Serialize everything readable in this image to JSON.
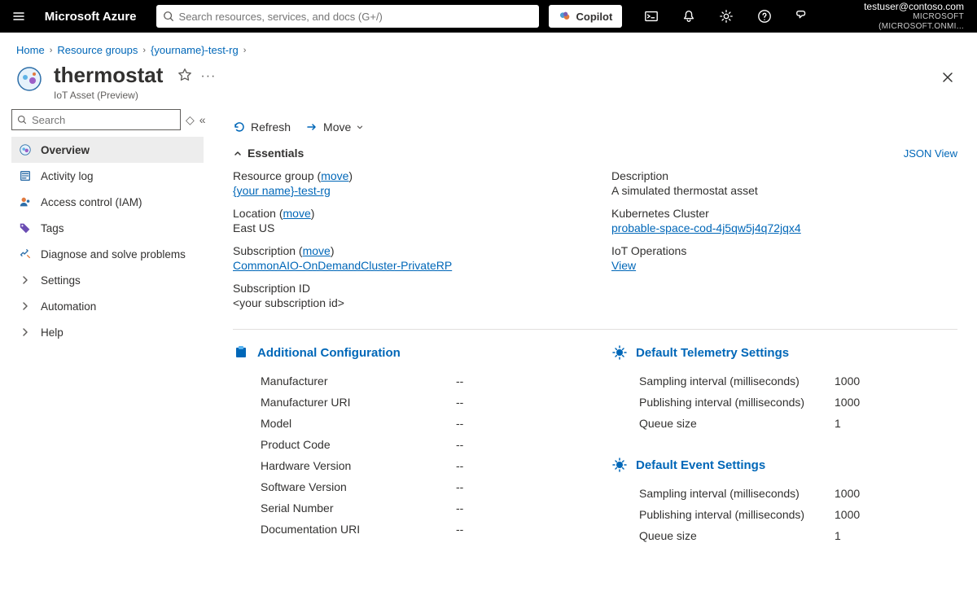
{
  "top": {
    "brand": "Microsoft Azure",
    "search_placeholder": "Search resources, services, and docs (G+/)",
    "copilot": "Copilot",
    "account_email": "testuser@contoso.com",
    "account_tenant": "MICROSOFT (MICROSOFT.ONMI..."
  },
  "breadcrumb": {
    "home": "Home",
    "rg": "Resource groups",
    "resource": "{yourname}-test-rg"
  },
  "header": {
    "title": "thermostat",
    "subtitle": "IoT Asset (Preview)"
  },
  "sidebar": {
    "search_placeholder": "Search",
    "items": [
      {
        "id": "overview",
        "label": "Overview"
      },
      {
        "id": "activity",
        "label": "Activity log"
      },
      {
        "id": "iam",
        "label": "Access control (IAM)"
      },
      {
        "id": "tags",
        "label": "Tags"
      },
      {
        "id": "diagnose",
        "label": "Diagnose and solve problems"
      },
      {
        "id": "settings",
        "label": "Settings"
      },
      {
        "id": "automation",
        "label": "Automation"
      },
      {
        "id": "help",
        "label": "Help"
      }
    ]
  },
  "toolbar": {
    "refresh": "Refresh",
    "move": "Move"
  },
  "essentials": {
    "title": "Essentials",
    "json_view": "JSON View",
    "move_label": "move",
    "labels": {
      "resource_group": "Resource group",
      "location": "Location",
      "subscription": "Subscription",
      "subscription_id": "Subscription ID",
      "description": "Description",
      "k8s": "Kubernetes Cluster",
      "iot_ops": "IoT Operations"
    },
    "values": {
      "resource_group": "{your name}-test-rg",
      "location": "East US",
      "subscription": "CommonAIO-OnDemandCluster-PrivateRP",
      "subscription_id": "<your subscription id>",
      "description": "A simulated thermostat asset",
      "k8s": "probable-space-cod-4j5qw5j4q72jqx4",
      "iot_ops": "View"
    }
  },
  "additional_config": {
    "title": "Additional Configuration",
    "rows": [
      {
        "k": "Manufacturer",
        "v": "--"
      },
      {
        "k": "Manufacturer URI",
        "v": "--"
      },
      {
        "k": "Model",
        "v": "--"
      },
      {
        "k": "Product Code",
        "v": "--"
      },
      {
        "k": "Hardware Version",
        "v": "--"
      },
      {
        "k": "Software Version",
        "v": "--"
      },
      {
        "k": "Serial Number",
        "v": "--"
      },
      {
        "k": "Documentation URI",
        "v": "--"
      }
    ]
  },
  "telemetry": {
    "title": "Default Telemetry Settings",
    "rows": [
      {
        "k": "Sampling interval (milliseconds)",
        "v": "1000"
      },
      {
        "k": "Publishing interval (milliseconds)",
        "v": "1000"
      },
      {
        "k": "Queue size",
        "v": "1"
      }
    ]
  },
  "events": {
    "title": "Default Event Settings",
    "rows": [
      {
        "k": "Sampling interval (milliseconds)",
        "v": "1000"
      },
      {
        "k": "Publishing interval (milliseconds)",
        "v": "1000"
      },
      {
        "k": "Queue size",
        "v": "1"
      }
    ]
  }
}
